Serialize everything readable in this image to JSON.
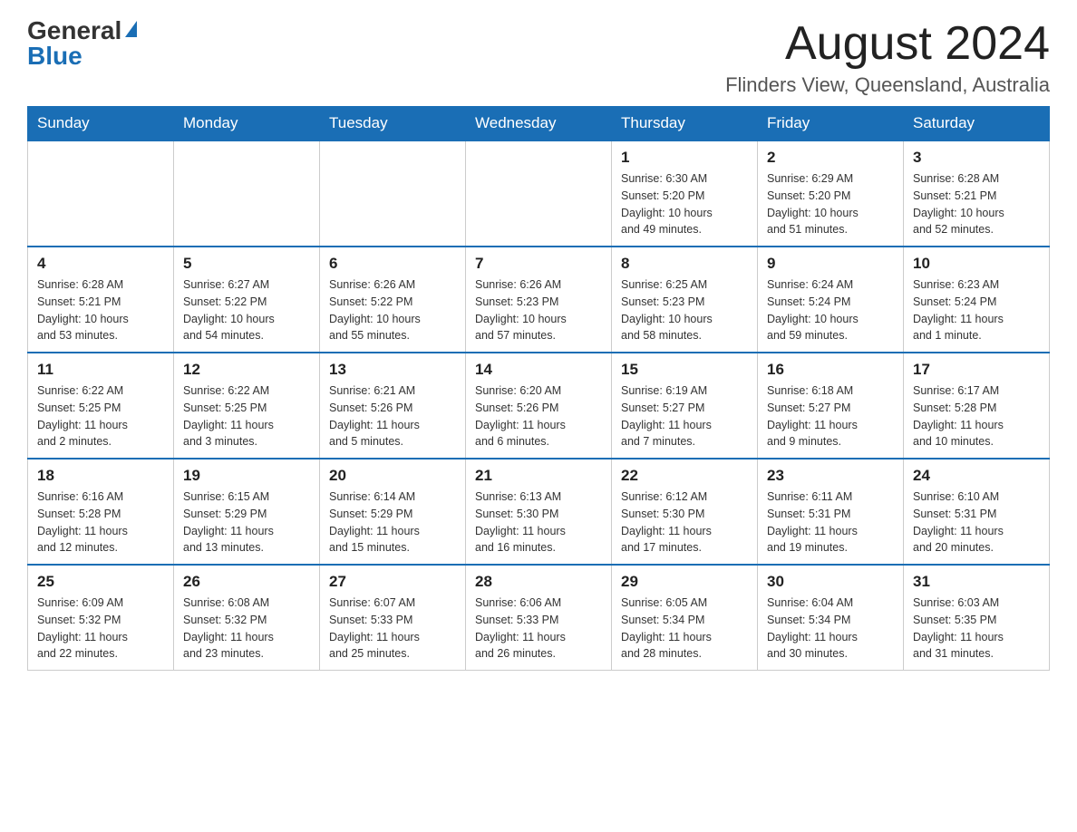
{
  "header": {
    "logo_general": "General",
    "logo_blue": "Blue",
    "month_title": "August 2024",
    "location": "Flinders View, Queensland, Australia"
  },
  "days_of_week": [
    "Sunday",
    "Monday",
    "Tuesday",
    "Wednesday",
    "Thursday",
    "Friday",
    "Saturday"
  ],
  "weeks": [
    [
      {
        "day": "",
        "info": ""
      },
      {
        "day": "",
        "info": ""
      },
      {
        "day": "",
        "info": ""
      },
      {
        "day": "",
        "info": ""
      },
      {
        "day": "1",
        "info": "Sunrise: 6:30 AM\nSunset: 5:20 PM\nDaylight: 10 hours\nand 49 minutes."
      },
      {
        "day": "2",
        "info": "Sunrise: 6:29 AM\nSunset: 5:20 PM\nDaylight: 10 hours\nand 51 minutes."
      },
      {
        "day": "3",
        "info": "Sunrise: 6:28 AM\nSunset: 5:21 PM\nDaylight: 10 hours\nand 52 minutes."
      }
    ],
    [
      {
        "day": "4",
        "info": "Sunrise: 6:28 AM\nSunset: 5:21 PM\nDaylight: 10 hours\nand 53 minutes."
      },
      {
        "day": "5",
        "info": "Sunrise: 6:27 AM\nSunset: 5:22 PM\nDaylight: 10 hours\nand 54 minutes."
      },
      {
        "day": "6",
        "info": "Sunrise: 6:26 AM\nSunset: 5:22 PM\nDaylight: 10 hours\nand 55 minutes."
      },
      {
        "day": "7",
        "info": "Sunrise: 6:26 AM\nSunset: 5:23 PM\nDaylight: 10 hours\nand 57 minutes."
      },
      {
        "day": "8",
        "info": "Sunrise: 6:25 AM\nSunset: 5:23 PM\nDaylight: 10 hours\nand 58 minutes."
      },
      {
        "day": "9",
        "info": "Sunrise: 6:24 AM\nSunset: 5:24 PM\nDaylight: 10 hours\nand 59 minutes."
      },
      {
        "day": "10",
        "info": "Sunrise: 6:23 AM\nSunset: 5:24 PM\nDaylight: 11 hours\nand 1 minute."
      }
    ],
    [
      {
        "day": "11",
        "info": "Sunrise: 6:22 AM\nSunset: 5:25 PM\nDaylight: 11 hours\nand 2 minutes."
      },
      {
        "day": "12",
        "info": "Sunrise: 6:22 AM\nSunset: 5:25 PM\nDaylight: 11 hours\nand 3 minutes."
      },
      {
        "day": "13",
        "info": "Sunrise: 6:21 AM\nSunset: 5:26 PM\nDaylight: 11 hours\nand 5 minutes."
      },
      {
        "day": "14",
        "info": "Sunrise: 6:20 AM\nSunset: 5:26 PM\nDaylight: 11 hours\nand 6 minutes."
      },
      {
        "day": "15",
        "info": "Sunrise: 6:19 AM\nSunset: 5:27 PM\nDaylight: 11 hours\nand 7 minutes."
      },
      {
        "day": "16",
        "info": "Sunrise: 6:18 AM\nSunset: 5:27 PM\nDaylight: 11 hours\nand 9 minutes."
      },
      {
        "day": "17",
        "info": "Sunrise: 6:17 AM\nSunset: 5:28 PM\nDaylight: 11 hours\nand 10 minutes."
      }
    ],
    [
      {
        "day": "18",
        "info": "Sunrise: 6:16 AM\nSunset: 5:28 PM\nDaylight: 11 hours\nand 12 minutes."
      },
      {
        "day": "19",
        "info": "Sunrise: 6:15 AM\nSunset: 5:29 PM\nDaylight: 11 hours\nand 13 minutes."
      },
      {
        "day": "20",
        "info": "Sunrise: 6:14 AM\nSunset: 5:29 PM\nDaylight: 11 hours\nand 15 minutes."
      },
      {
        "day": "21",
        "info": "Sunrise: 6:13 AM\nSunset: 5:30 PM\nDaylight: 11 hours\nand 16 minutes."
      },
      {
        "day": "22",
        "info": "Sunrise: 6:12 AM\nSunset: 5:30 PM\nDaylight: 11 hours\nand 17 minutes."
      },
      {
        "day": "23",
        "info": "Sunrise: 6:11 AM\nSunset: 5:31 PM\nDaylight: 11 hours\nand 19 minutes."
      },
      {
        "day": "24",
        "info": "Sunrise: 6:10 AM\nSunset: 5:31 PM\nDaylight: 11 hours\nand 20 minutes."
      }
    ],
    [
      {
        "day": "25",
        "info": "Sunrise: 6:09 AM\nSunset: 5:32 PM\nDaylight: 11 hours\nand 22 minutes."
      },
      {
        "day": "26",
        "info": "Sunrise: 6:08 AM\nSunset: 5:32 PM\nDaylight: 11 hours\nand 23 minutes."
      },
      {
        "day": "27",
        "info": "Sunrise: 6:07 AM\nSunset: 5:33 PM\nDaylight: 11 hours\nand 25 minutes."
      },
      {
        "day": "28",
        "info": "Sunrise: 6:06 AM\nSunset: 5:33 PM\nDaylight: 11 hours\nand 26 minutes."
      },
      {
        "day": "29",
        "info": "Sunrise: 6:05 AM\nSunset: 5:34 PM\nDaylight: 11 hours\nand 28 minutes."
      },
      {
        "day": "30",
        "info": "Sunrise: 6:04 AM\nSunset: 5:34 PM\nDaylight: 11 hours\nand 30 minutes."
      },
      {
        "day": "31",
        "info": "Sunrise: 6:03 AM\nSunset: 5:35 PM\nDaylight: 11 hours\nand 31 minutes."
      }
    ]
  ]
}
